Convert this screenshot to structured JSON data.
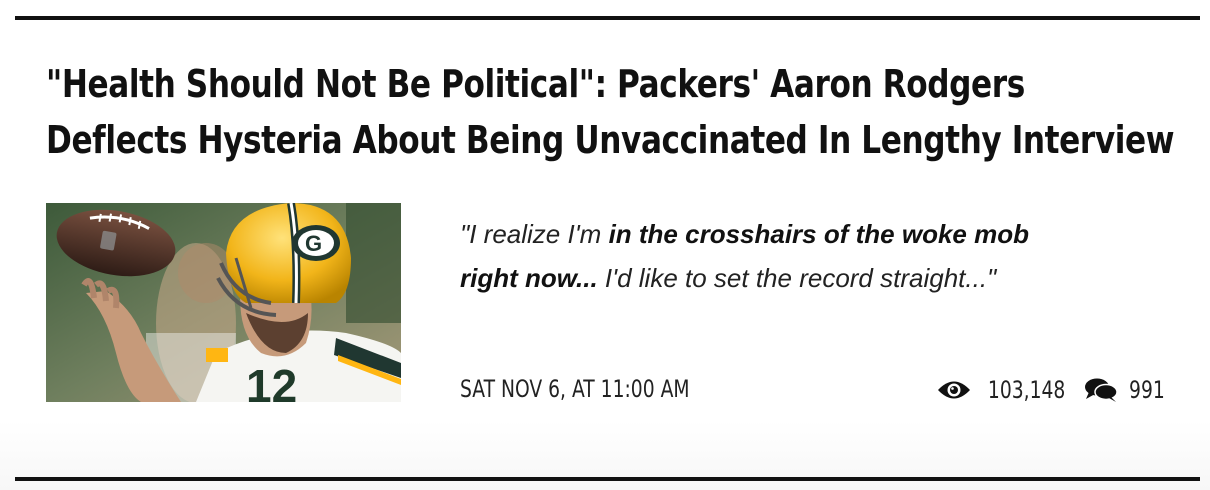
{
  "article": {
    "headline_line1": "\"Health Should Not Be Political\": Packers' Aaron Rodgers",
    "headline_line2": "Deflects Hysteria About Being Unvaccinated In Lengthy Interview",
    "teaser": {
      "open": "\"I realize I'm ",
      "bold1": "in the crosshairs of the woke mob",
      "break_bold": "right now...",
      "rest": " I'd like to set the record straight...\""
    },
    "date": "SAT NOV 6, AT 11:00 AM",
    "views": "103,148",
    "comments": "991",
    "thumbnail_alt": "Aaron Rodgers in Packers helmet spinning a football"
  },
  "icons": {
    "views": "eye-icon",
    "comments": "comments-icon"
  },
  "colors": {
    "text": "#111111",
    "rule": "#111111",
    "packers_green": "#203731",
    "packers_gold": "#FFB612"
  }
}
